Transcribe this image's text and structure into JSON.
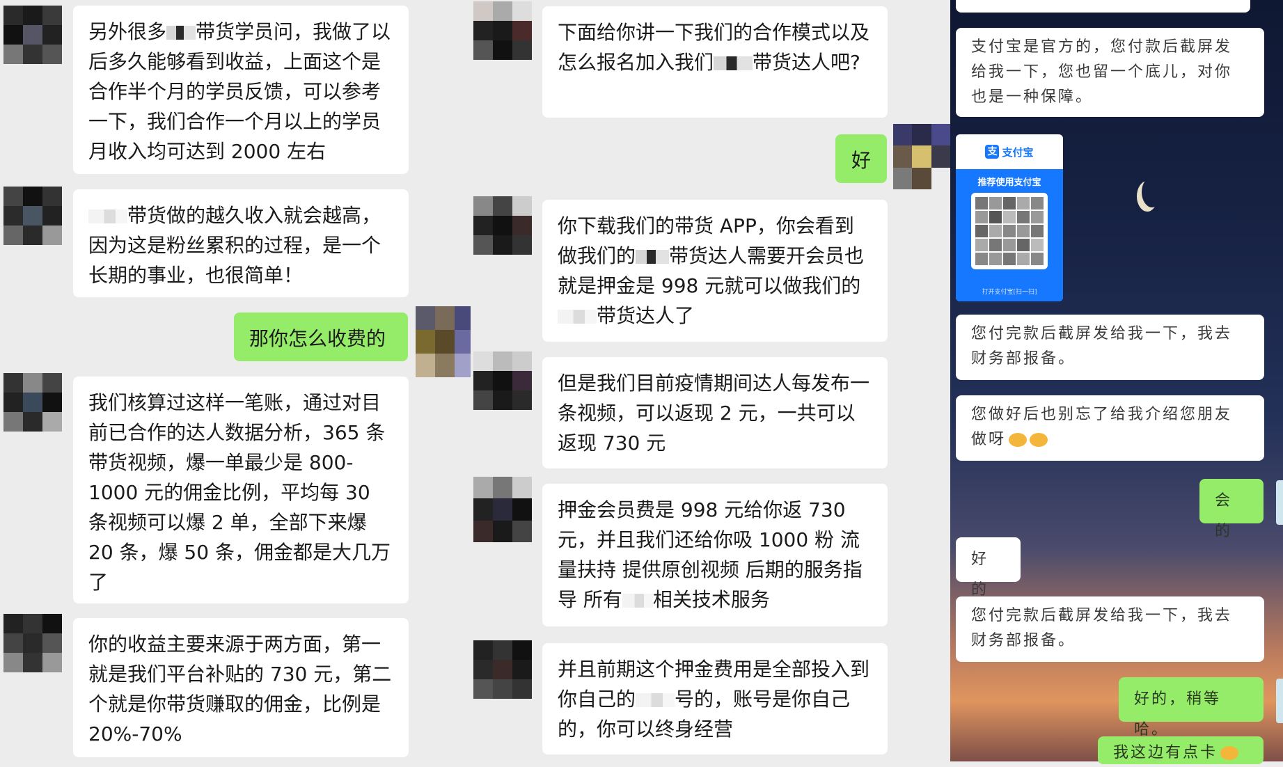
{
  "panel1": {
    "msg1": {
      "t1": "另外很多",
      "t2": "带货学员问，我做了以后多久能够看到收益，上面这个是合作半个月的学员反馈，可以参考一下，我们合作一个月以上的学员月收入均可达到 2000 左右"
    },
    "msg2": {
      "t1": "带货做的越久收入就会越高，因为这是粉丝累积的过程，是一个长期的事业，也很简单！"
    },
    "msg3": "那你怎么收费的",
    "msg4": "我们核算过这样一笔账，通过对目前已合作的达人数据分析，365 条带货视频，爆一单最少是 800-1000 元的佣金比例，平均每 30 条视频可以爆 2 单，全部下来爆 20 条，爆 50 条，佣金都是大几万了",
    "msg5": "你的收益主要来源于两方面，第一就是我们平台补贴的 730 元，第二个就是你带货赚取的佣金，比例是 20%-70%"
  },
  "panel2": {
    "msg1": {
      "t1": "下面给你讲一下我们的合作模式以及怎么报名加入我们",
      "t2": "带货达人吧?"
    },
    "msg2": "好",
    "msg3": {
      "t1": "你下载我们的带货 APP，你会看到做我们的",
      "t2": "带货达人需要开会员也就是押金是 998 元就可以做我们的",
      "t3": "带货达人了"
    },
    "msg4": "但是我们目前疫情期间达人每发布一条视频，可以返现 2 元，一共可以返现 730 元",
    "msg5": {
      "t1": "押金会员费是 998 元给你返 730 元，并且我们还给你吸 1000 粉 流量扶持 提供原创视频 后期的服务指导 所有",
      "t2": "相关技术服务"
    },
    "msg6": {
      "t1": "并且前期这个押金费用是全部投入到你自己的",
      "t2": "号的，账号是你自己的，你可以终身经营"
    }
  },
  "panel3": {
    "msg1": "支付宝是官方的，您付款后截屏发给我一下，您也留一个底儿，对你也是一种保障。",
    "qr": {
      "brand": "支付宝",
      "logo": "支",
      "title": "推荐使用支付宝",
      "foot": "打开支付宝[扫一扫]"
    },
    "msg2": "您付完款后截屏发给我一下，我去财务部报备。",
    "msg3": "您做好后也别忘了给我介绍您朋友做呀",
    "msg4": "会的",
    "msg5": "好的",
    "msg6": "您付完款后截屏发给我一下，我去财务部报备。",
    "msg7": "好的，稍等哈。",
    "msg8": "我这边有点卡"
  }
}
